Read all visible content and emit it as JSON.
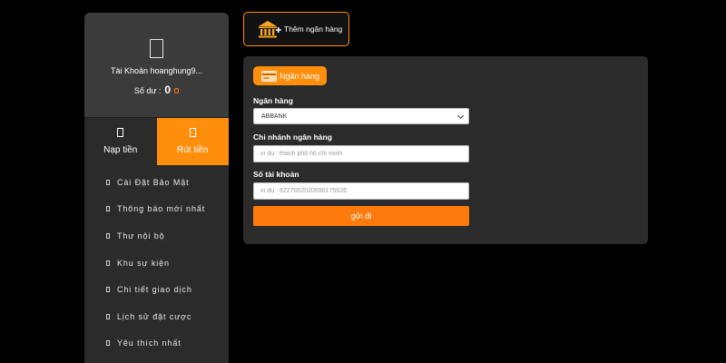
{
  "sidebar": {
    "account_label": "Tài Khoản hoanghung9...",
    "balance_label": "Số dư :",
    "balance_value": "0",
    "tabs": [
      {
        "label": "Nạp tiền"
      },
      {
        "label": "Rút tiền"
      }
    ],
    "menu": [
      {
        "label": "Cài Đặt Bảo Mật"
      },
      {
        "label": "Thông báo mới nhất"
      },
      {
        "label": "Thư nội bộ"
      },
      {
        "label": "Khu sự kiện"
      },
      {
        "label": "Chi tiết giao dịch"
      },
      {
        "label": "Lịch sử đặt cược"
      },
      {
        "label": "Yêu thích nhất"
      }
    ]
  },
  "add_bank": {
    "label": "Thêm ngân hàng",
    "icon": "bank-plus-icon"
  },
  "form": {
    "section_label": "Ngân hàng",
    "bank": {
      "label": "Ngân hàng",
      "value": "ABBANK"
    },
    "branch": {
      "label": "Chi nhánh ngân hàng",
      "placeholder": "ví dụ : thành phố hồ chí minh"
    },
    "account_number": {
      "label": "Số tài khoản",
      "placeholder": "ví dụ : 6227002020690175526"
    },
    "submit_label": "gửi đi"
  },
  "colors": {
    "accent": "#ff8e0c",
    "sidebar_bg": "#2b2b2b",
    "panel_bg": "#2b2b2b",
    "page_bg": "#000000"
  }
}
